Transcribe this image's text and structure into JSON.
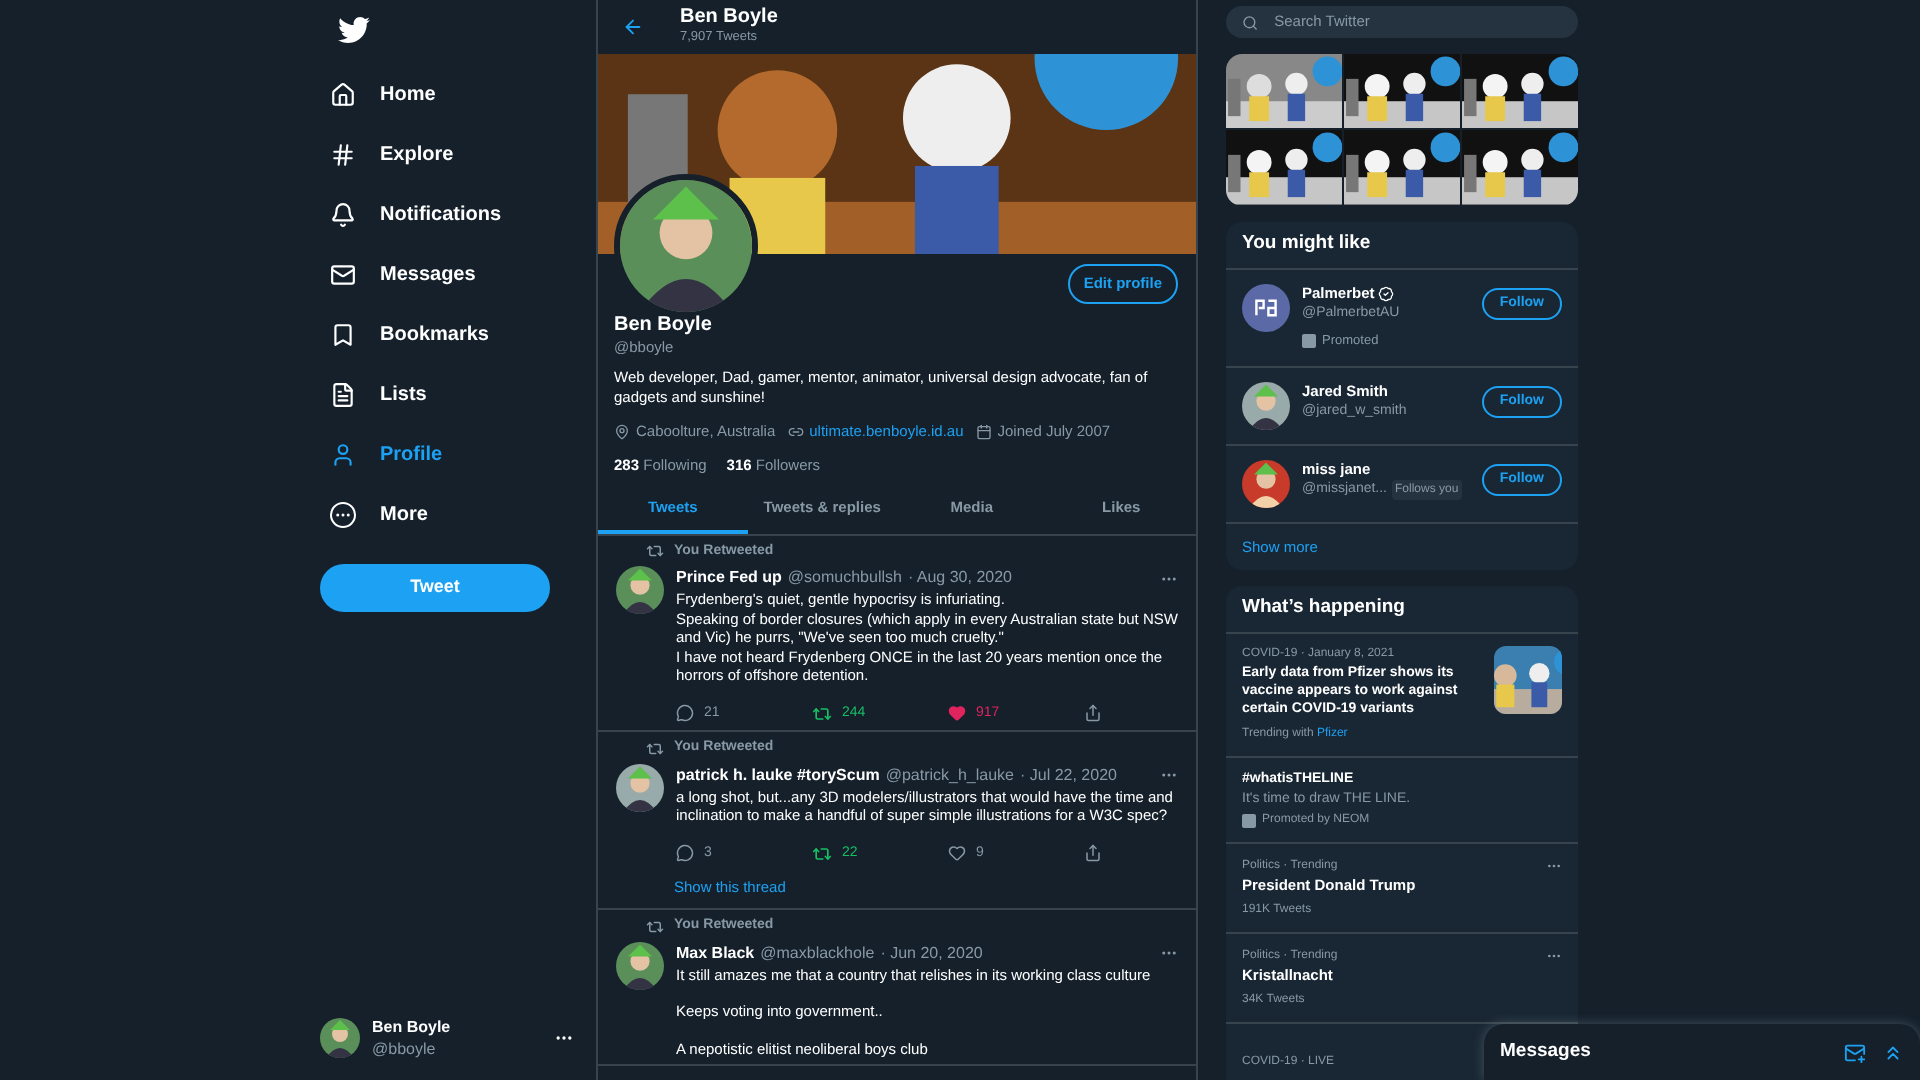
{
  "nav": {
    "items": [
      {
        "label": "Home",
        "selected": false
      },
      {
        "label": "Explore",
        "selected": false
      },
      {
        "label": "Notifications",
        "selected": false
      },
      {
        "label": "Messages",
        "selected": false
      },
      {
        "label": "Bookmarks",
        "selected": false
      },
      {
        "label": "Lists",
        "selected": false
      },
      {
        "label": "Profile",
        "selected": true
      },
      {
        "label": "More",
        "selected": false
      }
    ],
    "tweet_button": "Tweet",
    "account": {
      "name": "Ben Boyle",
      "handle": "@bboyle"
    }
  },
  "header": {
    "name": "Ben Boyle",
    "count": "7,907 Tweets"
  },
  "profile": {
    "edit_button": "Edit profile",
    "name": "Ben Boyle",
    "handle": "@bboyle",
    "bio": "Web developer, Dad, gamer, mentor, animator, universal design advocate, fan of gadgets and sunshine!",
    "location": "Caboolture, Australia",
    "website": "ultimate.benboyle.id.au",
    "joined": "Joined July 2007",
    "following_count": "283",
    "following_label": "Following",
    "followers_count": "316",
    "followers_label": "Followers"
  },
  "tabs": [
    {
      "label": "Tweets",
      "selected": true
    },
    {
      "label": "Tweets & replies",
      "selected": false
    },
    {
      "label": "Media",
      "selected": false
    },
    {
      "label": "Likes",
      "selected": false
    }
  ],
  "tweets": [
    {
      "context": "You Retweeted",
      "name": "Prince Fed up",
      "handle": "@somuchbullsh",
      "date": "· Aug 30, 2020",
      "paragraphs": [
        "Frydenberg's quiet, gentle hypocrisy is infuriating.\nSpeaking of border closures (which apply in every Australian state but NSW and Vic) he purrs, \"We've seen too much cruelty.\"\nI have not heard Frydenberg ONCE in the last 20 years mention once the horrors of offshore detention."
      ],
      "replies": "21",
      "retweets": "244",
      "retweeted": true,
      "likes": "917",
      "liked": true
    },
    {
      "context": "You Retweeted",
      "name": "patrick h. lauke #toryScum",
      "handle": "@patrick_h_lauke",
      "date": "· Jul 22, 2020",
      "paragraphs": [
        "a long shot, but...any 3D modelers/illustrators that would have the time and inclination to make a handful of super simple illustrations for a W3C spec?"
      ],
      "replies": "3",
      "retweets": "22",
      "retweeted": true,
      "likes": "9",
      "liked": false,
      "thread_link": "Show this thread"
    },
    {
      "context": "You Retweeted",
      "name": "Max Black",
      "handle": "@maxblackhole",
      "date": "· Jun 20, 2020",
      "paragraphs": [
        "It still amazes me that a country that relishes in its working class culture",
        "Keeps voting into government..",
        "A nepotistic elitist neoliberal boys club"
      ]
    }
  ],
  "search": {
    "placeholder": "Search Twitter"
  },
  "suggestions": {
    "title": "You might like",
    "users": [
      {
        "name": "Palmerbet",
        "handle": "@PalmerbetAU",
        "verified": true,
        "promoted": "Promoted",
        "button": "Follow"
      },
      {
        "name": "Jared Smith",
        "handle": "@jared_w_smith",
        "button": "Follow"
      },
      {
        "name": "miss jane",
        "handle": "@missjanet...",
        "follows_you": "Follows you",
        "button": "Follow"
      }
    ],
    "show_more": "Show more"
  },
  "trends": {
    "title": "What’s happening",
    "items": [
      {
        "kind": "news",
        "meta": "COVID-19 · January 8, 2021",
        "title": "Early data from Pfizer shows its vaccine appears to work against certain COVID-19 variants",
        "footer": "Trending with",
        "footer_link": "Pfizer"
      },
      {
        "kind": "promoted",
        "title": "#whatisTHELINE",
        "subtitle": "It's time to draw THE LINE.",
        "footer": "Promoted by NEOM"
      },
      {
        "kind": "trend",
        "meta": "Politics · Trending",
        "title": "President Donald Trump",
        "footer": "191K Tweets"
      },
      {
        "kind": "trend",
        "meta": "Politics · Trending",
        "title": "Kristallnacht",
        "footer": "34K Tweets"
      },
      {
        "kind": "live",
        "meta": "COVID-19 · LIVE"
      }
    ]
  },
  "messages_drawer": {
    "title": "Messages"
  }
}
